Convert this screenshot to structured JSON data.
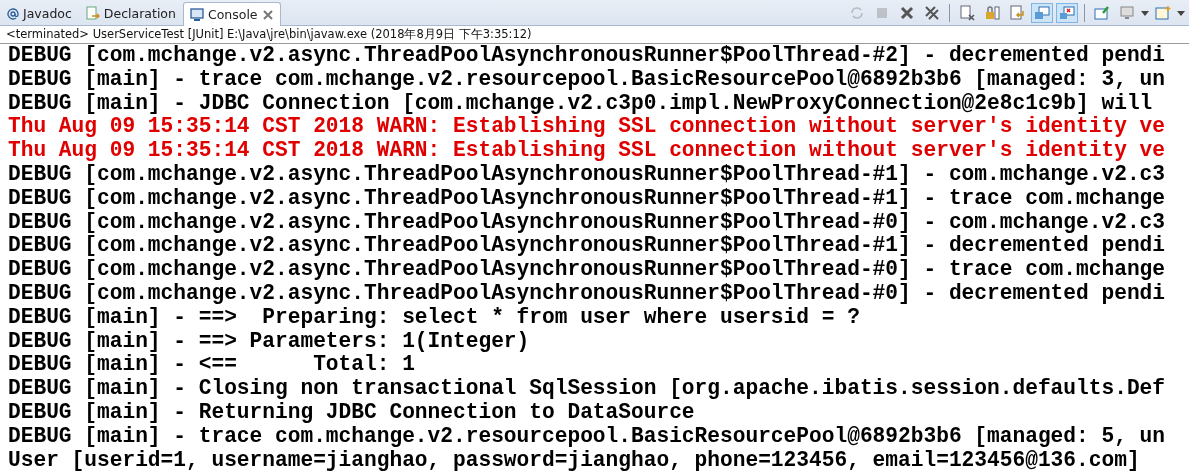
{
  "tabs": [
    {
      "label": "Javadoc",
      "kind": "at",
      "selected": false
    },
    {
      "label": "Declaration",
      "kind": "doc",
      "selected": false
    },
    {
      "label": "Console",
      "kind": "monitor",
      "selected": true,
      "closable": true
    }
  ],
  "toolbar": [
    {
      "kind": "sync",
      "disabled": true
    },
    {
      "kind": "stop",
      "disabled": true
    },
    {
      "kind": "remove",
      "disabled": false
    },
    {
      "kind": "remove-all",
      "disabled": false
    },
    {
      "kind": "sep"
    },
    {
      "kind": "clear",
      "disabled": false
    },
    {
      "kind": "lock",
      "disabled": false
    },
    {
      "kind": "wrap",
      "disabled": false
    },
    {
      "kind": "show-out",
      "selected": true
    },
    {
      "kind": "show-err",
      "selected": true
    },
    {
      "kind": "sep"
    },
    {
      "kind": "pin",
      "disabled": false
    },
    {
      "kind": "display",
      "dropdown": true
    },
    {
      "kind": "new",
      "dropdown": true
    }
  ],
  "status": "<terminated> UserServiceTest [JUnit] E:\\Java\\jre\\bin\\javaw.exe (2018年8月9日 下午3:35:12)",
  "lines": [
    {
      "kind": "debug",
      "text": "DEBUG [com.mchange.v2.async.ThreadPoolAsynchronousRunner$PoolThread-#2] - decremented pendi"
    },
    {
      "kind": "debug",
      "text": "DEBUG [main] - trace com.mchange.v2.resourcepool.BasicResourcePool@6892b3b6 [managed: 3, un"
    },
    {
      "kind": "debug",
      "text": "DEBUG [main] - JDBC Connection [com.mchange.v2.c3p0.impl.NewProxyConnection@2e8c1c9b] will"
    },
    {
      "kind": "warn",
      "text": "Thu Aug 09 15:35:14 CST 2018 WARN: Establishing SSL connection without server's identity ve"
    },
    {
      "kind": "warn",
      "text": "Thu Aug 09 15:35:14 CST 2018 WARN: Establishing SSL connection without server's identity ve"
    },
    {
      "kind": "debug",
      "text": "DEBUG [com.mchange.v2.async.ThreadPoolAsynchronousRunner$PoolThread-#1] - com.mchange.v2.c3"
    },
    {
      "kind": "debug",
      "text": "DEBUG [com.mchange.v2.async.ThreadPoolAsynchronousRunner$PoolThread-#1] - trace com.mchange"
    },
    {
      "kind": "debug",
      "text": "DEBUG [com.mchange.v2.async.ThreadPoolAsynchronousRunner$PoolThread-#0] - com.mchange.v2.c3"
    },
    {
      "kind": "debug",
      "text": "DEBUG [com.mchange.v2.async.ThreadPoolAsynchronousRunner$PoolThread-#1] - decremented pendi"
    },
    {
      "kind": "debug",
      "text": "DEBUG [com.mchange.v2.async.ThreadPoolAsynchronousRunner$PoolThread-#0] - trace com.mchange"
    },
    {
      "kind": "debug",
      "text": "DEBUG [com.mchange.v2.async.ThreadPoolAsynchronousRunner$PoolThread-#0] - decremented pendi"
    },
    {
      "kind": "debug",
      "text": "DEBUG [main] - ==>  Preparing: select * from user where usersid = ? "
    },
    {
      "kind": "debug",
      "text": "DEBUG [main] - ==> Parameters: 1(Integer)"
    },
    {
      "kind": "debug",
      "text": "DEBUG [main] - <==      Total: 1"
    },
    {
      "kind": "debug",
      "text": "DEBUG [main] - Closing non transactional SqlSession [org.apache.ibatis.session.defaults.Def"
    },
    {
      "kind": "debug",
      "text": "DEBUG [main] - Returning JDBC Connection to DataSource"
    },
    {
      "kind": "debug",
      "text": "DEBUG [main] - trace com.mchange.v2.resourcepool.BasicResourcePool@6892b3b6 [managed: 5, un"
    },
    {
      "kind": "output",
      "text": "User [userid=1, username=jianghao, password=jianghao, phone=123456, email=123456@136.com]"
    }
  ]
}
